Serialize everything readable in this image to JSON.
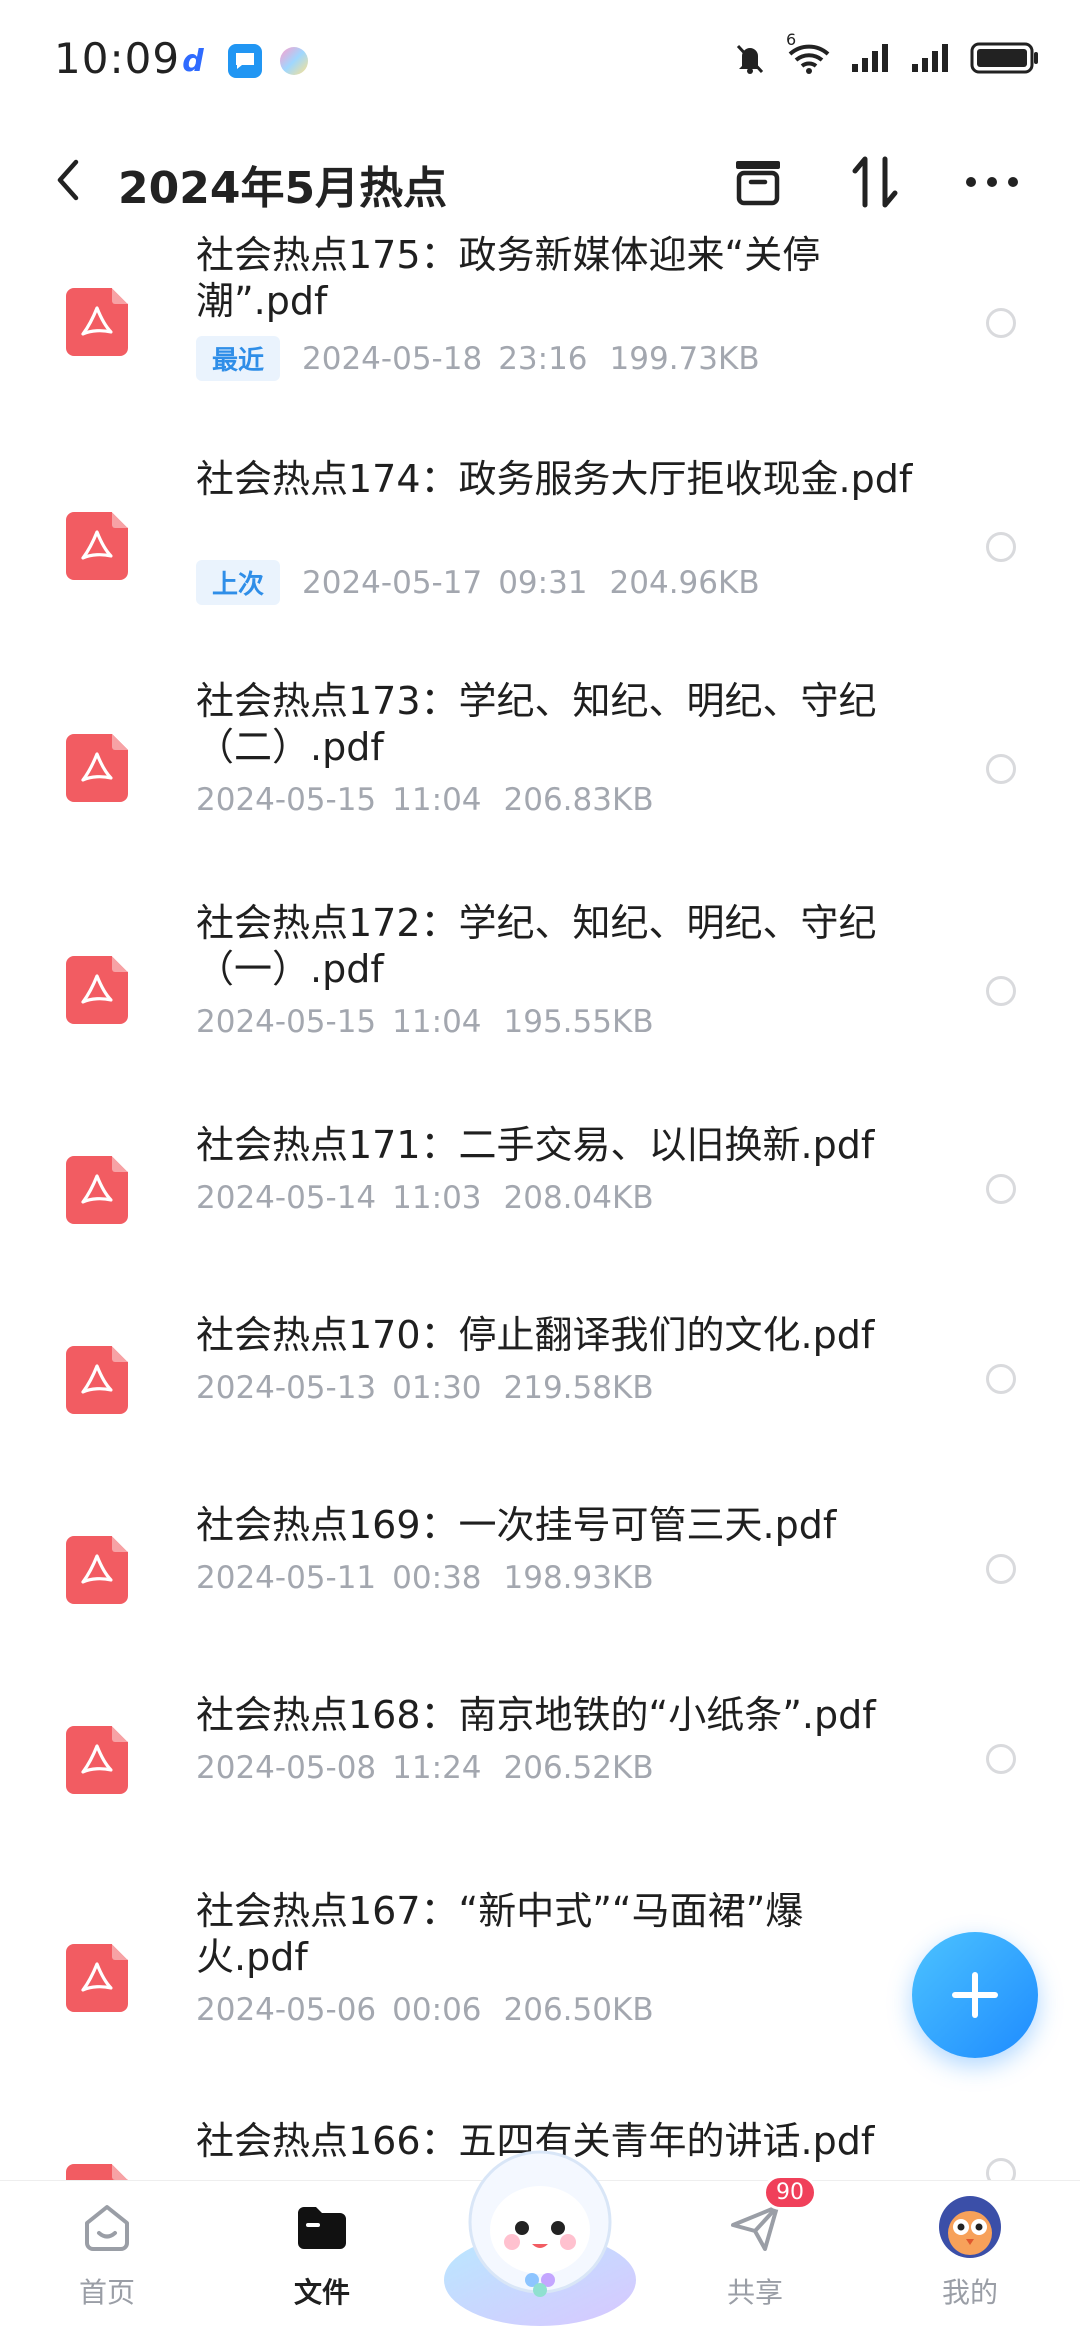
{
  "status_bar": {
    "time": "10:09",
    "network_label": "6"
  },
  "header": {
    "title": "2024年5月热点"
  },
  "files": [
    {
      "name": "社会热点175：政务新媒体迎来“关停潮”.pdf",
      "tag": "最近",
      "date": "2024-05-18",
      "time": "23:16",
      "size": "199.73KB"
    },
    {
      "name": "社会热点174：政务服务大厅拒收现金.pdf",
      "tag": "上次",
      "date": "2024-05-17",
      "time": "09:31",
      "size": "204.96KB"
    },
    {
      "name": "社会热点173：学纪、知纪、明纪、守纪（二）.pdf",
      "tag": "",
      "date": "2024-05-15",
      "time": "11:04",
      "size": "206.83KB"
    },
    {
      "name": "社会热点172：学纪、知纪、明纪、守纪（一）.pdf",
      "tag": "",
      "date": "2024-05-15",
      "time": "11:04",
      "size": "195.55KB"
    },
    {
      "name": "社会热点171：二手交易、以旧换新.pdf",
      "tag": "",
      "date": "2024-05-14",
      "time": "11:03",
      "size": "208.04KB"
    },
    {
      "name": "社会热点170：停止翻译我们的文化.pdf",
      "tag": "",
      "date": "2024-05-13",
      "time": "01:30",
      "size": "219.58KB"
    },
    {
      "name": "社会热点169：一次挂号可管三天.pdf",
      "tag": "",
      "date": "2024-05-11",
      "time": "00:38",
      "size": "198.93KB"
    },
    {
      "name": "社会热点168：南京地铁的“小纸条”.pdf",
      "tag": "",
      "date": "2024-05-08",
      "time": "11:24",
      "size": "206.52KB"
    },
    {
      "name": "社会热点167：“新中式”“马面裙”爆火.pdf",
      "tag": "",
      "date": "2024-05-06",
      "time": "00:06",
      "size": "206.50KB"
    },
    {
      "name": "社会热点166：五四有关青年的讲话.pdf",
      "tag": "",
      "date": "",
      "time": "",
      "size": ""
    }
  ],
  "bottom_nav": {
    "home": "首页",
    "files": "文件",
    "share": "共享",
    "share_badge": "90",
    "mine": "我的"
  },
  "colors": {
    "accent": "#1e8bff",
    "pdf": "#f25c62",
    "tag_bg": "#eaf3fd",
    "tag_text": "#2f8ee8",
    "meta_text": "#a3a7af",
    "badge": "#f0405a"
  }
}
